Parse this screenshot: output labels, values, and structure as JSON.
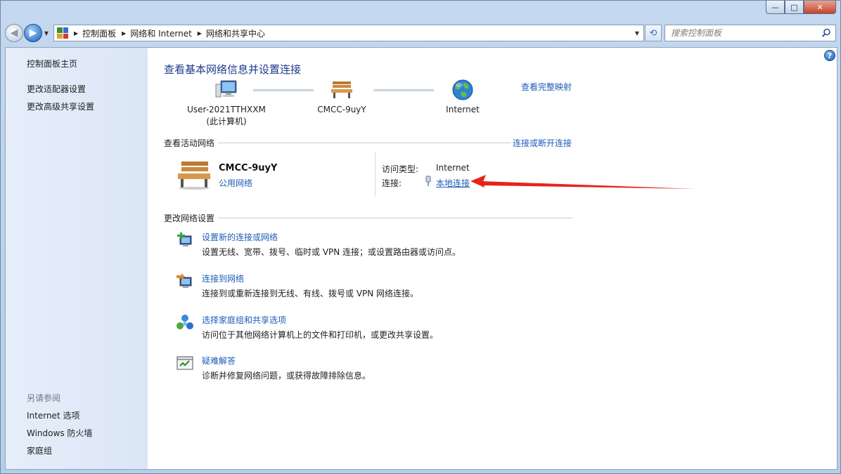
{
  "window": {
    "caption_min": "—",
    "caption_max": "□",
    "caption_close": "✕"
  },
  "nav": {
    "breadcrumbs": [
      "控制面板",
      "网络和 Internet",
      "网络和共享中心"
    ],
    "search_placeholder": "搜索控制面板"
  },
  "sidebar": {
    "items": [
      "控制面板主页",
      "更改适配器设置",
      "更改高级共享设置"
    ],
    "see_also_label": "另请参阅",
    "see_also": [
      "Internet 选项",
      "Windows 防火墙",
      "家庭组"
    ]
  },
  "main": {
    "title": "查看基本网络信息并设置连接",
    "map_link": "查看完整映射",
    "nodes": [
      {
        "line1": "User-2021TTHXXM",
        "line2": "(此计算机)"
      },
      {
        "line1": "CMCC-9uyY",
        "line2": ""
      },
      {
        "line1": "Internet",
        "line2": ""
      }
    ],
    "active_section": "查看活动网络",
    "connect_disconnect": "连接或断开连接",
    "network": {
      "name": "CMCC-9uyY",
      "type": "公用网络",
      "access_type_label": "访问类型:",
      "access_type_value": "Internet",
      "connection_label": "连接:",
      "connection_value": "本地连接"
    },
    "change_section": "更改网络设置",
    "tasks": [
      {
        "title": "设置新的连接或网络",
        "desc": "设置无线、宽带、拨号、临时或 VPN 连接；或设置路由器或访问点。"
      },
      {
        "title": "连接到网络",
        "desc": "连接到或重新连接到无线、有线、拨号或 VPN 网络连接。"
      },
      {
        "title": "选择家庭组和共享选项",
        "desc": "访问位于其他网络计算机上的文件和打印机，或更改共享设置。"
      },
      {
        "title": "疑难解答",
        "desc": "诊断并修复网络问题，或获得故障排除信息。"
      }
    ]
  },
  "colors": {
    "link": "#1c5cb8",
    "title": "#1e3a8c",
    "annotation_arrow": "#e8231c"
  }
}
